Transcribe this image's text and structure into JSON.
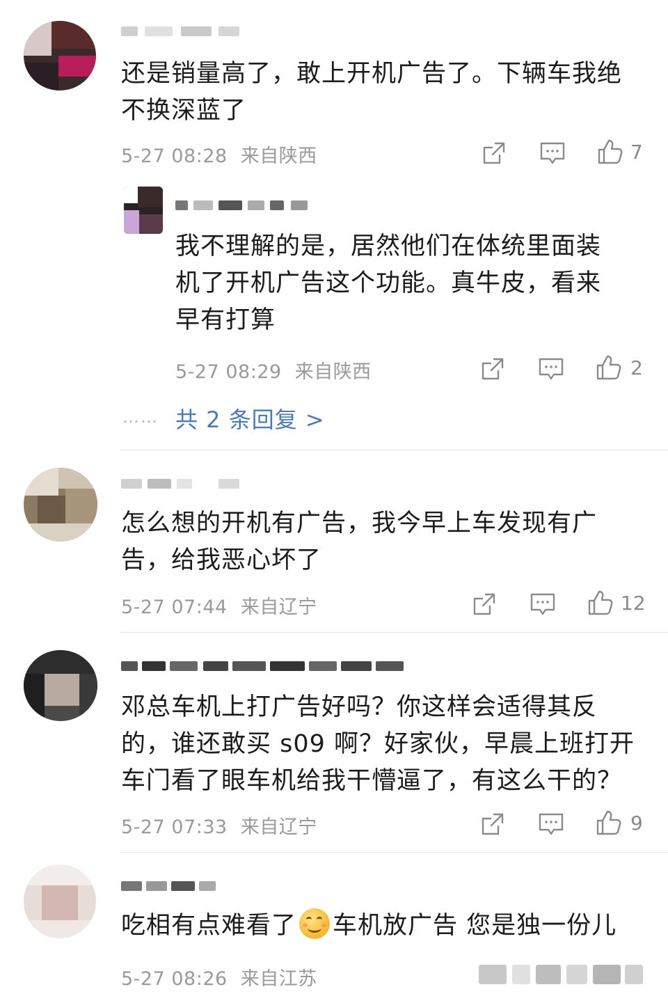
{
  "comments": [
    {
      "text_lines": [
        "还是销量高了，敢上开机广告了。下辆车我绝",
        "不换深蓝了"
      ],
      "time": "5-27 08:28",
      "location": "来自陕西",
      "likes": "7",
      "replies": [
        {
          "text_lines": [
            "我不理解的是，居然他们在体统里面装",
            "机了开机广告这个功能。真牛皮，看来",
            "早有打算"
          ],
          "time": "5-27 08:29",
          "location": "来自陕西",
          "likes": "2"
        }
      ],
      "more_replies": "共 2 条回复 >",
      "more_dots": "……"
    },
    {
      "text_lines": [
        "怎么想的开机有广告，我今早上车发现有广",
        "告，给我恶心坏了"
      ],
      "time": "5-27 07:44",
      "location": "来自辽宁",
      "likes": "12"
    },
    {
      "text_lines": [
        "邓总车机上打广告好吗？你这样会适得其反",
        "的，谁还敢买 s09 啊？好家伙，早晨上班打开",
        "车门看了眼车机给我干懵逼了，有这么干的？"
      ],
      "time": "5-27 07:33",
      "location": "来自辽宁",
      "likes": "9"
    },
    {
      "text_before_emoji": "吃相有点难看了",
      "text_after_emoji": "车机放广告 您是独一份儿",
      "time": "5-27 08:26",
      "location": "来自江苏"
    }
  ],
  "icons": {
    "share": "share-icon",
    "comment": "comment-icon",
    "like": "thumbs-up-icon"
  },
  "colors": {
    "link": "#4a79b8",
    "meta": "#9a9a9a",
    "divider": "#e6e6e6"
  }
}
